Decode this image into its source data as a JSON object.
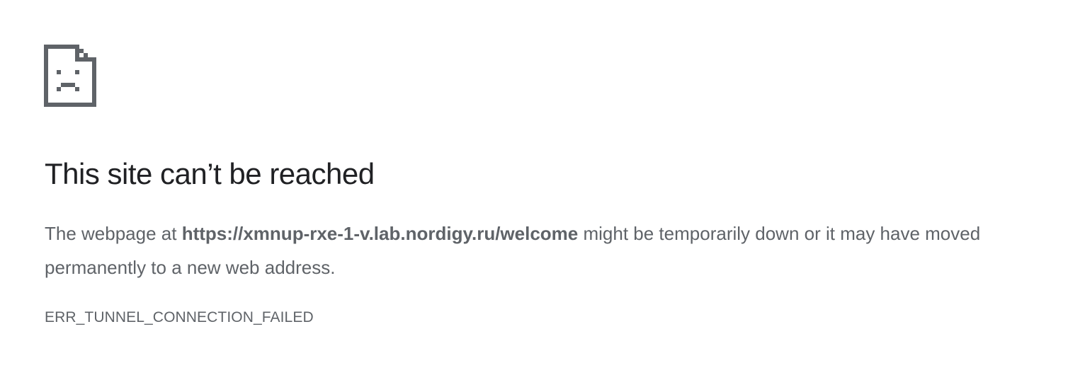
{
  "error_page": {
    "icon": "sad-page-icon",
    "icon_color": "#5f6368",
    "title": "This site can’t be reached",
    "description": {
      "before_url": "The webpage at ",
      "url": "https://xmnup-rxe-1-v.lab.nordigy.ru/welcome",
      "after_url": " might be temporarily down or it may have moved permanently to a new web address."
    },
    "error_code": "ERR_TUNNEL_CONNECTION_FAILED"
  }
}
